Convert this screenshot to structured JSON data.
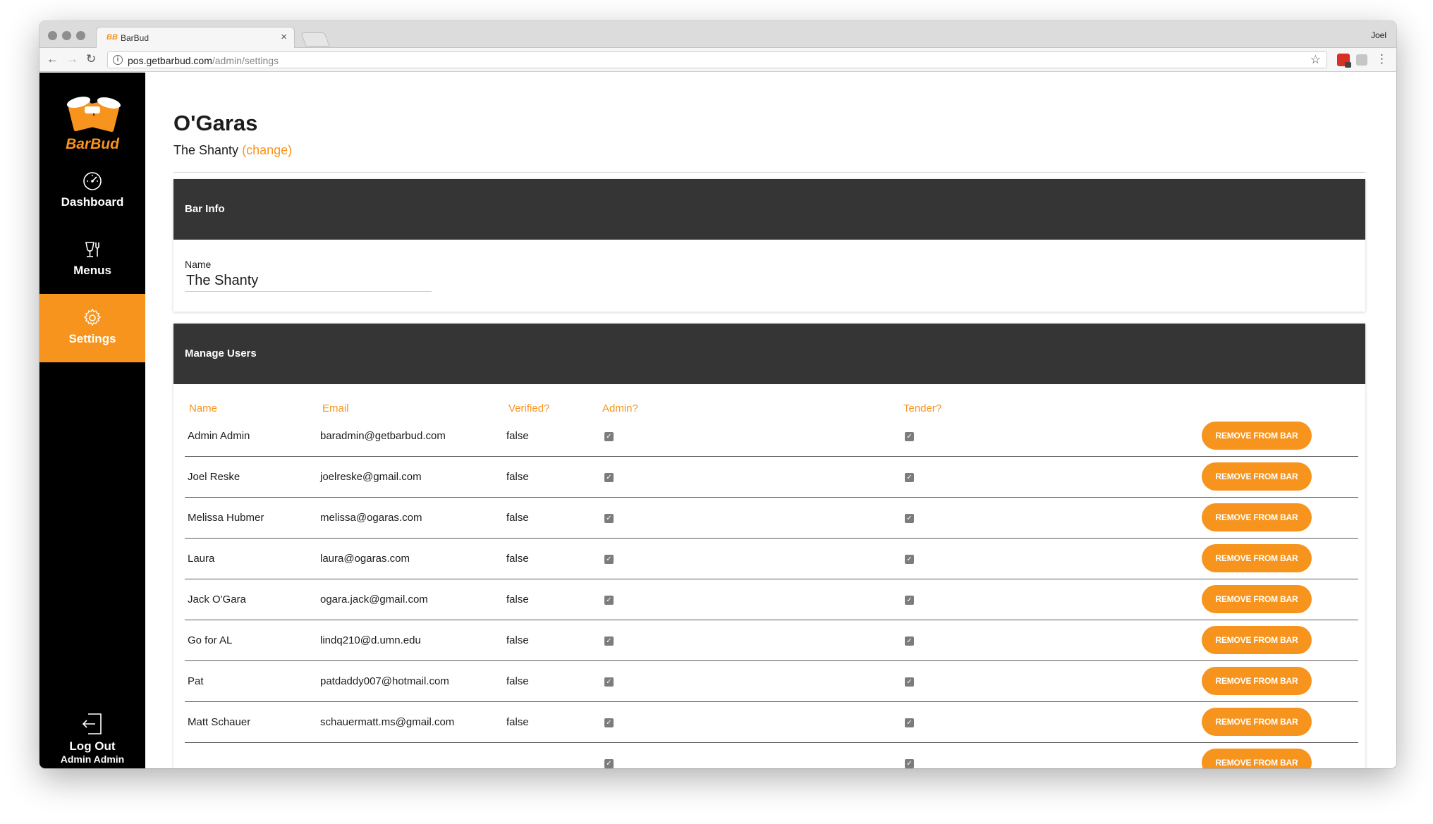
{
  "browser": {
    "tab_title": "BarBud",
    "favicon_text": "BB",
    "profile_name": "Joel",
    "url_host": "pos.getbarbud.com",
    "url_path": "/admin/settings"
  },
  "sidebar": {
    "logo_text": "BarBud",
    "items": [
      {
        "label": "Dashboard",
        "icon": "speedometer-icon"
      },
      {
        "label": "Menus",
        "icon": "drinks-icon"
      },
      {
        "label": "Settings",
        "icon": "gear-icon",
        "active": true
      }
    ],
    "logout_label": "Log Out",
    "current_user": "Admin Admin"
  },
  "header": {
    "bar_name": "O'Garas",
    "location": "The Shanty",
    "change_link": "(change)"
  },
  "bar_info": {
    "title": "Bar Info",
    "name_label": "Name",
    "name_value": "The Shanty"
  },
  "manage_users": {
    "title": "Manage Users",
    "columns": [
      "Name",
      "Email",
      "Verified?",
      "Admin?",
      "Tender?"
    ],
    "remove_label": "REMOVE FROM BAR",
    "rows": [
      {
        "name": "Admin Admin",
        "email": "baradmin@getbarbud.com",
        "verified": "false",
        "admin": true,
        "tender": true
      },
      {
        "name": "Joel Reske",
        "email": "joelreske@gmail.com",
        "verified": "false",
        "admin": true,
        "tender": true
      },
      {
        "name": "Melissa Hubmer",
        "email": "melissa@ogaras.com",
        "verified": "false",
        "admin": true,
        "tender": true
      },
      {
        "name": "Laura",
        "email": "laura@ogaras.com",
        "verified": "false",
        "admin": true,
        "tender": true
      },
      {
        "name": "Jack O'Gara",
        "email": "ogara.jack@gmail.com",
        "verified": "false",
        "admin": true,
        "tender": true
      },
      {
        "name": "Go for AL",
        "email": "lindq210@d.umn.edu",
        "verified": "false",
        "admin": true,
        "tender": true
      },
      {
        "name": "Pat",
        "email": "patdaddy007@hotmail.com",
        "verified": "false",
        "admin": true,
        "tender": true
      },
      {
        "name": "Matt Schauer",
        "email": "schauermatt.ms@gmail.com",
        "verified": "false",
        "admin": true,
        "tender": true
      },
      {
        "name": "",
        "email": "",
        "verified": "",
        "admin": true,
        "tender": true
      }
    ]
  },
  "colors": {
    "accent": "#f7941d",
    "sidebar_bg": "#000000",
    "card_header_bg": "#353535"
  }
}
